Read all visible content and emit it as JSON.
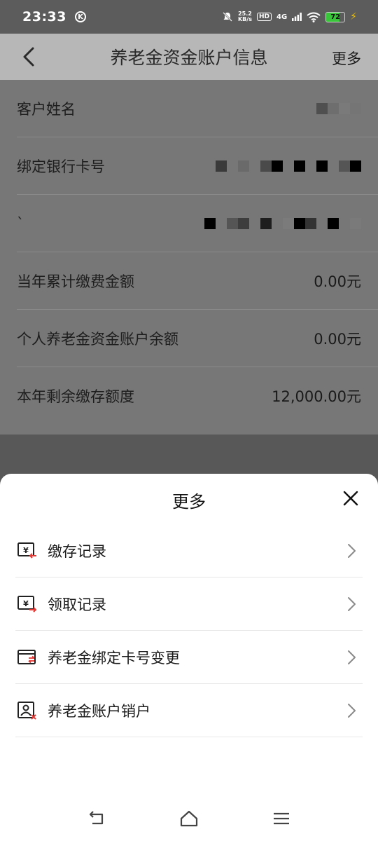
{
  "status_bar": {
    "time": "23:33",
    "k_badge": "K",
    "speed_value": "25.2",
    "speed_unit": "KB/s",
    "hd": "HD",
    "network": "4G",
    "battery_level": 72,
    "battery_label": "72"
  },
  "header": {
    "title": "养老金资金账户信息",
    "more_label": "更多"
  },
  "info_rows": [
    {
      "label": "客户姓名",
      "value": ""
    },
    {
      "label": "绑定银行卡号",
      "value": ""
    },
    {
      "label": "`",
      "value": ""
    },
    {
      "label": "当年累计缴费金额",
      "value": "0.00元"
    },
    {
      "label": "个人养老金资金账户余额",
      "value": "0.00元"
    },
    {
      "label": "本年剩余缴存额度",
      "value": "12,000.00元"
    }
  ],
  "sheet": {
    "title": "更多",
    "items": [
      {
        "label": "缴存记录",
        "icon": "deposit-record-icon"
      },
      {
        "label": "领取记录",
        "icon": "withdraw-record-icon"
      },
      {
        "label": "养老金绑定卡号变更",
        "icon": "card-change-icon"
      },
      {
        "label": "养老金账户销户",
        "icon": "account-close-icon"
      }
    ]
  },
  "colors": {
    "overlay": "#777777",
    "navbar": "#b7b7b7",
    "accent_red": "#e53935",
    "battery_green": "#3ac63a"
  }
}
